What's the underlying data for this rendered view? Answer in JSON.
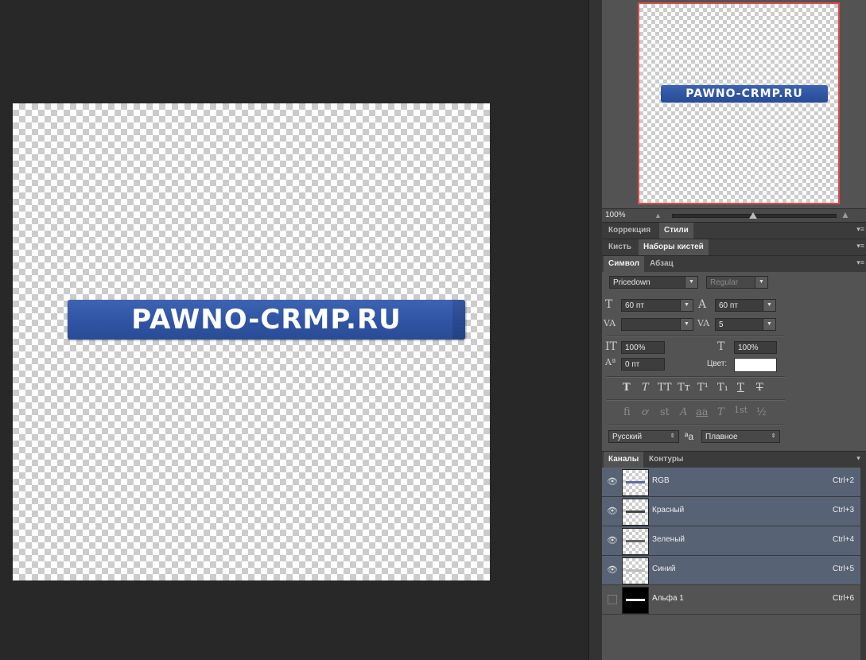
{
  "canvas": {
    "banner_text": "PAWNO-CRMP.RU",
    "banner_color": "#2f54a3"
  },
  "navigator": {
    "zoom": "100%",
    "frame_color": "#e04a4a"
  },
  "tabs": {
    "row1": [
      "Коррекция",
      "Стили"
    ],
    "row2": [
      "Кисть",
      "Наборы кистей"
    ],
    "row3": [
      "Символ",
      "Абзац"
    ],
    "row4": [
      "Каналы",
      "Контуры"
    ]
  },
  "character": {
    "font_family": "Pricedown",
    "font_style": "Regular",
    "font_size": "60 пт",
    "leading": "60 пт",
    "kerning": "",
    "tracking": "5",
    "vertical_scale": "100%",
    "horizontal_scale": "100%",
    "baseline_shift": "0 пт",
    "color_label": "Цвет:",
    "color_value": "#ffffff",
    "style_buttons": [
      "T",
      "T",
      "TT",
      "Tт",
      "T¹",
      "T₁",
      "T",
      "T"
    ],
    "opentype_buttons": [
      "ﬁ",
      "ơ",
      "st",
      "A",
      "aa",
      "T",
      "1st",
      "½"
    ],
    "language": "Русский",
    "aa_icon": "ªa",
    "antialias": "Плавное"
  },
  "channels": [
    {
      "name": "RGB",
      "shortcut": "Ctrl+2",
      "visible": true,
      "selected": true,
      "stripe": "#5a6fa8"
    },
    {
      "name": "Красный",
      "shortcut": "Ctrl+3",
      "visible": true,
      "selected": true,
      "stripe": "#444444"
    },
    {
      "name": "Зеленый",
      "shortcut": "Ctrl+4",
      "visible": true,
      "selected": true,
      "stripe": "#666666"
    },
    {
      "name": "Синий",
      "shortcut": "Ctrl+5",
      "visible": true,
      "selected": true,
      "stripe": "#bbbbbb"
    },
    {
      "name": "Альфа 1",
      "shortcut": "Ctrl+6",
      "visible": false,
      "selected": false,
      "stripe": "#ffffff"
    }
  ],
  "icons": {
    "eye": "eye-icon",
    "panel_menu": "panel-menu-icon",
    "zoom_out": "zoom-out-icon",
    "zoom_in": "zoom-in-icon"
  }
}
